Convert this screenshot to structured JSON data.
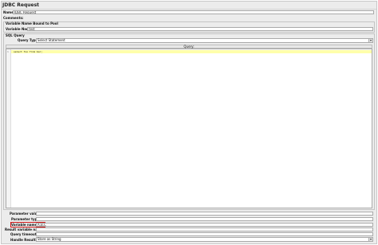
{
  "panel": {
    "title": "JDBC Request",
    "name_label": "Name:",
    "name_value": "JDBC Request",
    "comments_label": "Comments:",
    "pool_section_label": "Variable Name Bound to Pool",
    "variable_name_label": "Variable Name:",
    "variable_name_value": "test",
    "sql_section_label": "SQL Query",
    "query_type_label": "Query Type:",
    "query_type_value": "Select Statement",
    "query_header": "Query:",
    "editor": {
      "line_number": "1",
      "code": "select foo from bar;"
    },
    "params": {
      "parameter_values_label": "Parameter values:",
      "parameter_values_value": "",
      "parameter_types_label": "Parameter types:",
      "parameter_types_value": "",
      "variable_names_label": "Variable names:",
      "variable_names_value": "A,B,C",
      "result_variable_label": "Result variable name:",
      "result_variable_value": "",
      "query_timeout_label": "Query timeout (s):",
      "query_timeout_value": "",
      "handle_resultset_label": "Handle ResultSet:",
      "handle_resultset_value": "Store as String"
    }
  },
  "colors": {
    "background": "#ececec",
    "current_line": "#ffffaa",
    "highlight_border": "#d01818"
  },
  "icons": {
    "dropdown": "chevron-down-icon"
  }
}
